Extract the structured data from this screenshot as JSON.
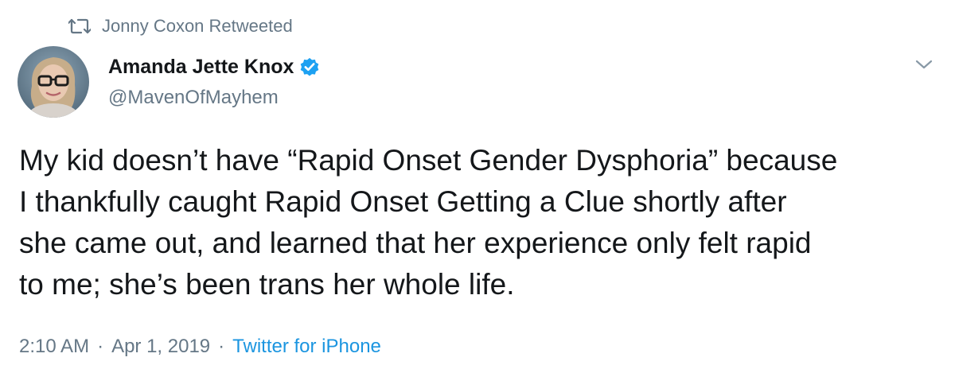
{
  "retweet": {
    "icon": "retweet-icon",
    "label": "Jonny Coxon Retweeted"
  },
  "author": {
    "name": "Amanda Jette Knox",
    "handle": "@MavenOfMayhem",
    "verified": true,
    "verified_color": "#1da1f2"
  },
  "tweet": {
    "lines": [
      "My kid doesn’t have “Rapid Onset Gender Dysphoria” because",
      "I thankfully caught Rapid Onset Getting a Clue shortly after",
      "she came out, and learned that her experience only felt rapid",
      "to me; she’s been trans her whole life."
    ]
  },
  "meta": {
    "time": "2:10 AM",
    "separator": "·",
    "date": "Apr 1, 2019",
    "source": "Twitter for iPhone",
    "source_color": "#1b95e0"
  },
  "icons": {
    "menu": "chevron-down-icon",
    "verified": "verified-badge-icon",
    "avatar": "avatar"
  },
  "colors": {
    "secondary_text": "#657786",
    "primary_text": "#14171a",
    "background": "#ffffff"
  }
}
